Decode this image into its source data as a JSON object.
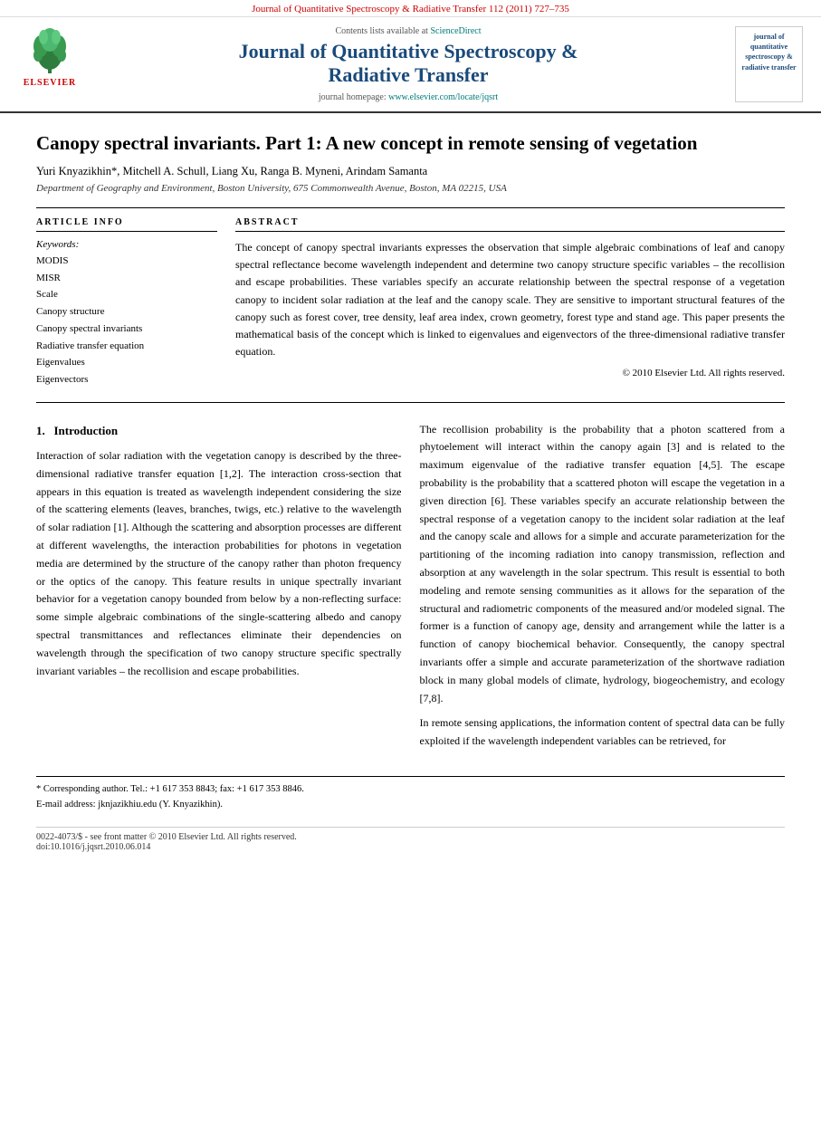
{
  "topbar": {
    "text": "Journal of Quantitative Spectroscopy & Radiative Transfer 112 (2011) 727–735"
  },
  "header": {
    "sciencedirect_label": "Contents lists available at",
    "sciencedirect_link": "ScienceDirect",
    "journal_title_line1": "Journal of Quantitative Spectroscopy &",
    "journal_title_line2": "Radiative Transfer",
    "homepage_label": "journal homepage:",
    "homepage_link": "www.elsevier.com/locate/jqsrt",
    "elsevier_text": "ELSEVIER",
    "thumb_title": "journal of quantitative spectroscopy & radiative transfer"
  },
  "article": {
    "title": "Canopy spectral invariants. Part 1: A new concept in remote sensing of vegetation",
    "authors": "Yuri Knyazikhin*, Mitchell A. Schull, Liang Xu, Ranga B. Myneni, Arindam Samanta",
    "affiliation": "Department of Geography and Environment, Boston University, 675 Commonwealth Avenue, Boston, MA 02215, USA"
  },
  "article_info": {
    "section_title": "ARTICLE INFO",
    "keywords_label": "Keywords:",
    "keywords": [
      "MODIS",
      "MISR",
      "Scale",
      "Canopy structure",
      "Canopy spectral invariants",
      "Radiative transfer equation",
      "Eigenvalues",
      "Eigenvectors"
    ]
  },
  "abstract": {
    "section_title": "ABSTRACT",
    "text": "The concept of canopy spectral invariants expresses the observation that simple algebraic combinations of leaf and canopy spectral reflectance become wavelength independent and determine two canopy structure specific variables – the recollision and escape probabilities. These variables specify an accurate relationship between the spectral response of a vegetation canopy to incident solar radiation at the leaf and the canopy scale. They are sensitive to important structural features of the canopy such as forest cover, tree density, leaf area index, crown geometry, forest type and stand age. This paper presents the mathematical basis of the concept which is linked to eigenvalues and eigenvectors of the three-dimensional radiative transfer equation.",
    "copyright": "© 2010 Elsevier Ltd. All rights reserved."
  },
  "body": {
    "left_col": {
      "section": "1.  Introduction",
      "paragraphs": [
        "Interaction of solar radiation with the vegetation canopy is described by the three-dimensional radiative transfer equation [1,2]. The interaction cross-section that appears in this equation is treated as wavelength independent considering the size of the scattering elements (leaves, branches, twigs, etc.) relative to the wavelength of solar radiation [1]. Although the scattering and absorption processes are different at different wavelengths, the interaction probabilities for photons in vegetation media are determined by the structure of the canopy rather than photon frequency or the optics of the canopy. This feature results in unique spectrally invariant behavior for a vegetation canopy bounded from below by a non-reflecting surface: some simple algebraic combinations of the single-scattering albedo and canopy spectral transmittances and reflectances eliminate their dependencies on wavelength through the specification of two canopy structure specific spectrally invariant variables – the recollision and escape probabilities."
      ]
    },
    "right_col": {
      "paragraphs": [
        "The recollision probability is the probability that a photon scattered from a phytoelement will interact within the canopy again [3] and is related to the maximum eigenvalue of the radiative transfer equation [4,5]. The escape probability is the probability that a scattered photon will escape the vegetation in a given direction [6]. These variables specify an accurate relationship between the spectral response of a vegetation canopy to the incident solar radiation at the leaf and the canopy scale and allows for a simple and accurate parameterization for the partitioning of the incoming radiation into canopy transmission, reflection and absorption at any wavelength in the solar spectrum. This result is essential to both modeling and remote sensing communities as it allows for the separation of the structural and radiometric components of the measured and/or modeled signal. The former is a function of canopy age, density and arrangement while the latter is a function of canopy biochemical behavior. Consequently, the canopy spectral invariants offer a simple and accurate parameterization of the shortwave radiation block in many global models of climate, hydrology, biogeochemistry, and ecology [7,8].",
        "In remote sensing applications, the information content of spectral data can be fully exploited if the wavelength independent variables can be retrieved, for"
      ]
    }
  },
  "footnotes": {
    "corresponding_author": "* Corresponding author. Tel.: +1 617 353 8843; fax: +1 617 353 8846.",
    "email": "E-mail address: jknjazikhiu.edu (Y. Knyazikhin).",
    "bottom_bar": "0022-4073/$ - see front matter © 2010 Elsevier Ltd. All rights reserved.\ndoi:10.1016/j.jqsrt.2010.06.014"
  }
}
